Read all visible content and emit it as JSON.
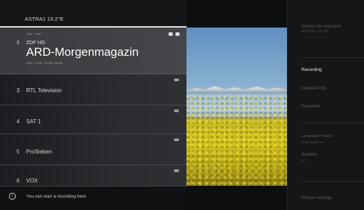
{
  "header": {
    "satellite": "ASTRA1 19.2°E"
  },
  "selected": {
    "time": "8:00 - 9:05",
    "number": "2",
    "channel": "ZDF HD",
    "title": "ARD-Morgenmagazin",
    "meta": "ARD - 8:05 - Family Series"
  },
  "channels": [
    {
      "number": "3",
      "name": "RTL Television"
    },
    {
      "number": "4",
      "name": "SAT 1"
    },
    {
      "number": "5",
      "name": "ProSieben"
    },
    {
      "number": "6",
      "name": "VOX"
    }
  ],
  "hint": {
    "icon": "info-icon",
    "text": "You can start a recording here"
  },
  "menu": {
    "satellite_title": "Station list selection",
    "satellite_value": "ASTRA1 19.2°E",
    "recording": "Recording",
    "details": "Detailed info",
    "favourite": "Favourite",
    "language": "Language / sound",
    "language_value": "Dolby Digital 2.0",
    "subtitles": "Subtitles",
    "subtitles_value": "off",
    "picture_settings": "Picture settings"
  }
}
